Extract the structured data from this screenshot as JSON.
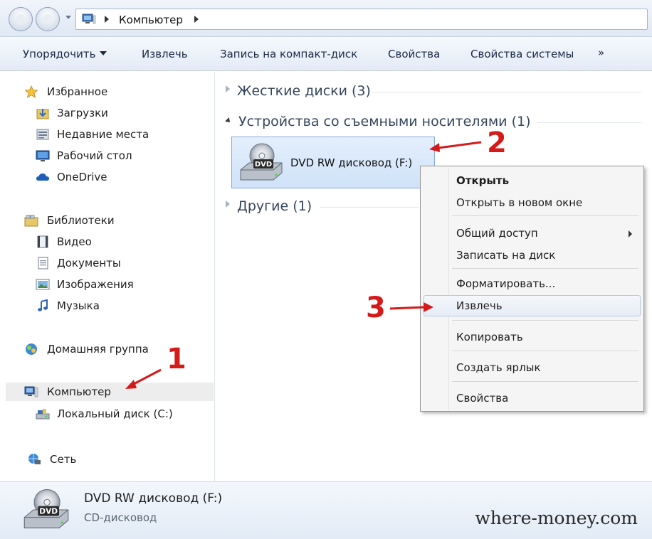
{
  "address_bar": {
    "path": "Компьютер"
  },
  "toolbar": {
    "organize": "Упорядочить",
    "eject": "Извлечь",
    "burn": "Запись на компакт-диск",
    "properties": "Свойства",
    "system_properties": "Свойства системы",
    "overflow": "»"
  },
  "nav": {
    "favorites": "Избранное",
    "downloads": "Загрузки",
    "recent": "Недавние места",
    "desktop": "Рабочий стол",
    "onedrive": "OneDrive",
    "libraries": "Библиотеки",
    "video": "Видео",
    "documents": "Документы",
    "pictures": "Изображения",
    "music": "Музыка",
    "homegroup": "Домашняя группа",
    "computer": "Компьютер",
    "local_disk": "Локальный диск (C:)",
    "network": "Сеть"
  },
  "content": {
    "hard_disks": "Жесткие диски (3)",
    "removable": "Устройства со съемными носителями (1)",
    "other": "Другие (1)",
    "dvd_drive": "DVD RW дисковод (F:)",
    "dvd_badge": "DVD"
  },
  "context_menu": {
    "open": "Открыть",
    "open_new_window": "Открыть в новом окне",
    "share": "Общий доступ",
    "burn_disc": "Записать на диск",
    "format": "Форматировать...",
    "eject": "Извлечь",
    "copy": "Копировать",
    "create_shortcut": "Создать ярлык",
    "properties": "Свойства"
  },
  "annotations": {
    "step1": "1",
    "step2": "2",
    "step3": "3",
    "accent_color": "#d51a1a"
  },
  "details": {
    "name": "DVD RW дисковод (F:)",
    "type": "CD-дисковод",
    "badge": "DVD"
  },
  "watermark": "where-money.com"
}
